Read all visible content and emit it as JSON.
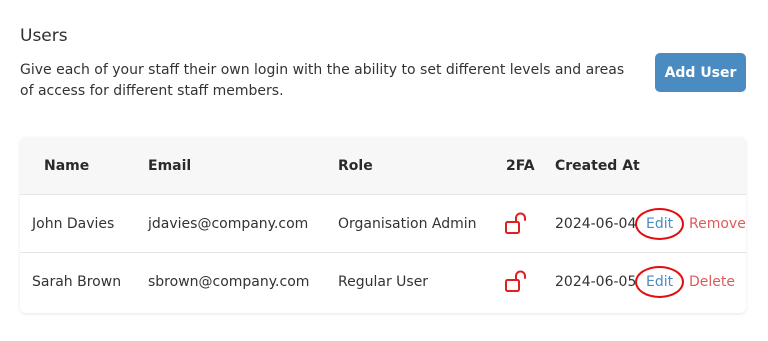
{
  "header": {
    "title": "Users",
    "description": "Give each of your staff their own login with the ability to set different levels and areas of access for different staff members.",
    "add_button_label": "Add User"
  },
  "table": {
    "columns": [
      "Name",
      "Email",
      "Role",
      "2FA",
      "Created At"
    ],
    "rows": [
      {
        "name": "John Davies",
        "email": "jdavies@company.com",
        "role": "Organisation Admin",
        "twofa_icon": "unlocked-padlock-icon",
        "created_at": "2024-06-04",
        "edit_label": "Edit",
        "action_label": "Remove"
      },
      {
        "name": "Sarah Brown",
        "email": "sbrown@company.com",
        "role": "Regular User",
        "twofa_icon": "unlocked-padlock-icon",
        "created_at": "2024-06-05",
        "edit_label": "Edit",
        "action_label": "Delete"
      }
    ]
  },
  "colors": {
    "accent": "#4a8bc2",
    "danger": "#e05a5a",
    "highlight": "#e01010"
  }
}
